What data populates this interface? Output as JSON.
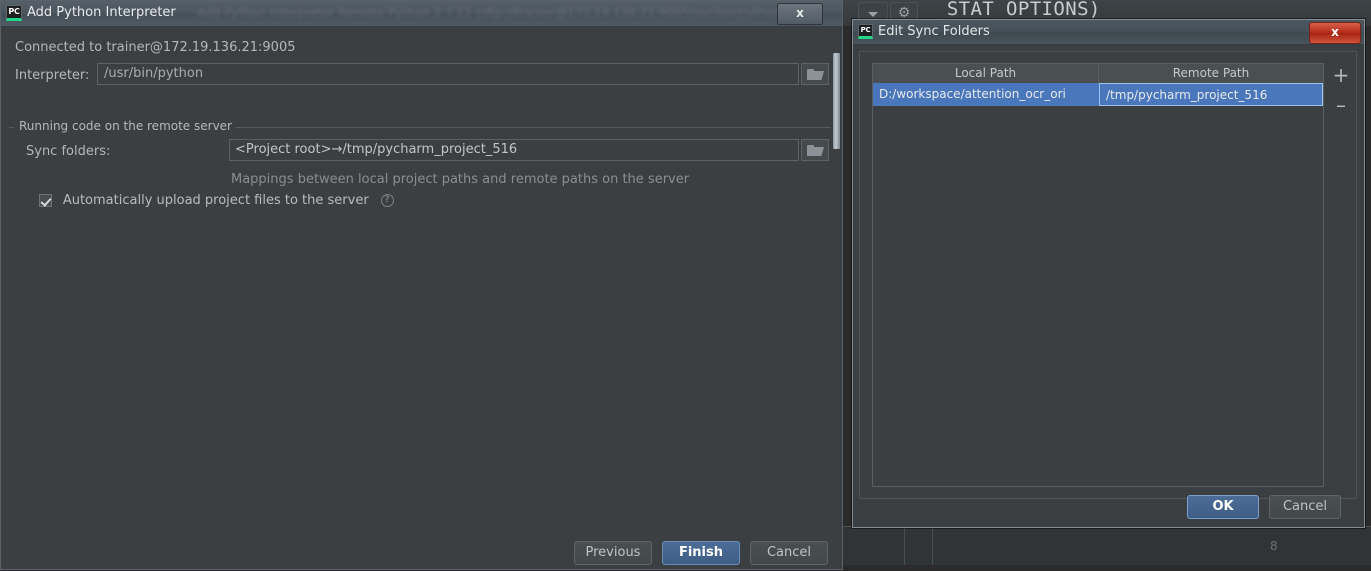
{
  "ide": {
    "code_fragment": "_STAT_OPTIONS)",
    "status_number": "8",
    "dropdown_icon": "chevron-down-icon",
    "gear_icon": "gear-icon"
  },
  "interpreter_dialog": {
    "title": "Add Python Interpreter",
    "title_ghost": "Add Python Interpreter    Remote Python 2.7.12 (sftp://trainer@172.19.136.21:9005/usr/bin/python)",
    "close_label": "x",
    "connected_text": "Connected to trainer@172.19.136.21:9005",
    "interpreter_label": "Interpreter:",
    "interpreter_value": "/usr/bin/python",
    "browse_icon": "folder-icon",
    "group_title": "Running code on the remote server",
    "sync_label": "Sync folders:",
    "sync_value": "<Project root>→/tmp/pycharm_project_516",
    "mapping_hint": "Mappings between local project paths and remote paths on the server",
    "auto_upload_label": "Automatically upload project files to the server",
    "auto_upload_checked": true,
    "help_icon": "help-icon",
    "buttons": {
      "previous": "Previous",
      "finish": "Finish",
      "cancel": "Cancel"
    }
  },
  "sync_dialog": {
    "title": "Edit Sync Folders",
    "close_label": "x",
    "table": {
      "columns": [
        "Local Path",
        "Remote Path"
      ],
      "rows": [
        {
          "local_path": "D:/workspace/attention_ocr_ori",
          "remote_path": "/tmp/pycharm_project_516",
          "selected": true
        }
      ]
    },
    "add_label": "+",
    "remove_label": "–",
    "buttons": {
      "ok": "OK",
      "cancel": "Cancel"
    }
  },
  "colors": {
    "dialog_bg": "#3c3f41",
    "selection_blue": "#4a76bb",
    "primary_button": "#3f5e86",
    "close_red": "#b32a17",
    "accent_green": "#21d789"
  }
}
